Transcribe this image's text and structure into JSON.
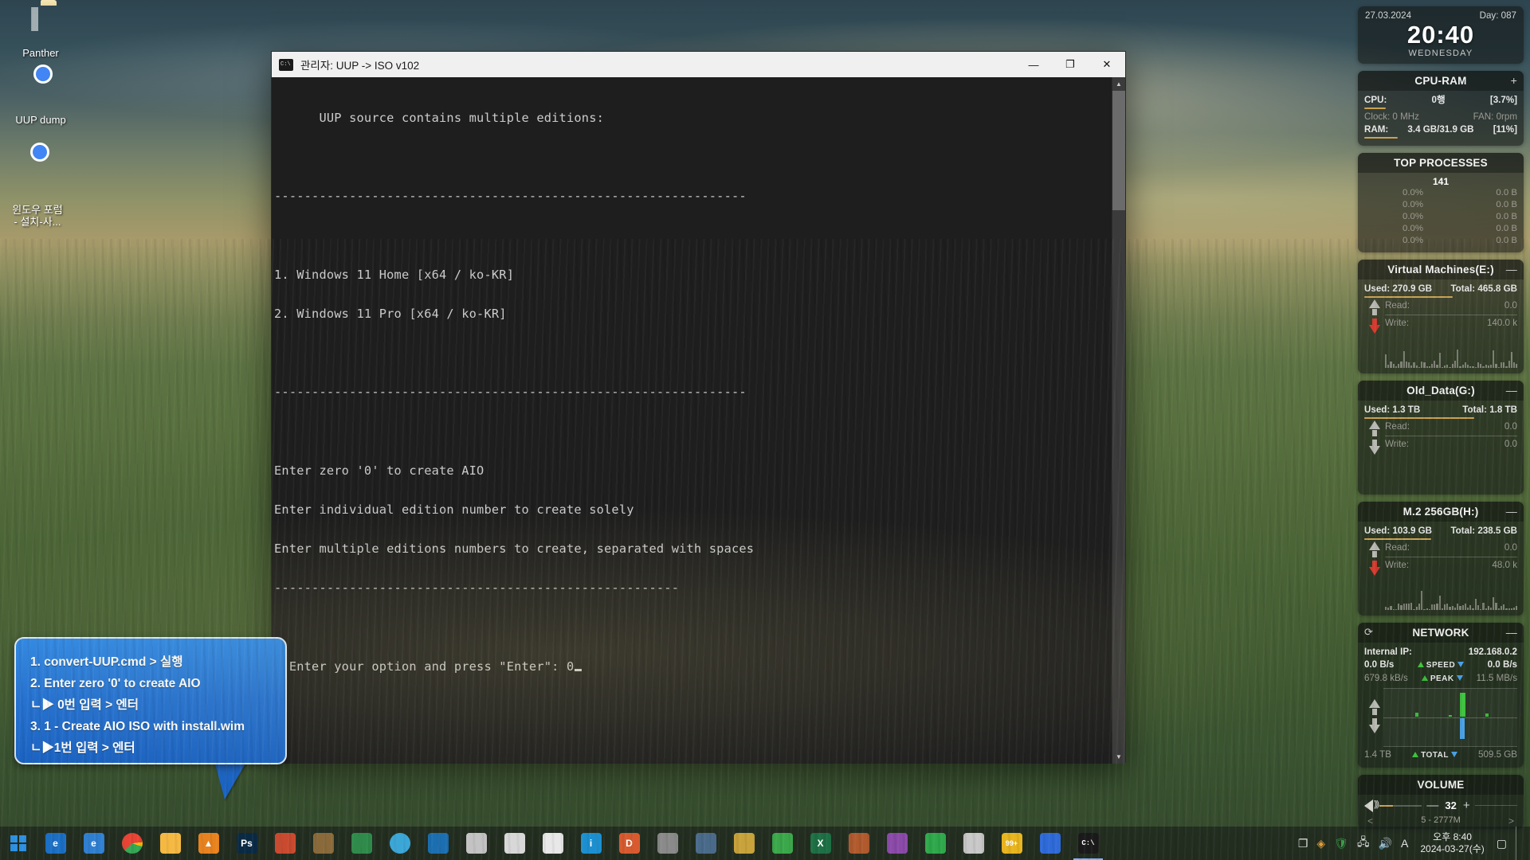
{
  "desktop": {
    "icons": [
      {
        "name": "Panther",
        "icon": "folder-icon"
      },
      {
        "name": "UUP dump",
        "icon": "chrome-icon"
      },
      {
        "name": "윈도우 포럼\n- 설치-사...",
        "icon": "chrome-icon"
      }
    ]
  },
  "console_window": {
    "title": "관리자:  UUP -> ISO v102",
    "icon": "cmd-icon",
    "buttons": {
      "minimize": "—",
      "maximize": "❐",
      "close": "✕"
    },
    "scrollbar": {
      "up": "▲",
      "down": "▼"
    },
    "lines": [
      "      UUP source contains multiple editions:",
      "",
      "---------------------------------------------------------------",
      "",
      "1. Windows 11 Home [x64 / ko-KR]",
      "2. Windows 11 Pro [x64 / ko-KR]",
      "",
      "---------------------------------------------------------------",
      "",
      "Enter zero '0' to create AIO",
      "Enter individual edition number to create solely",
      "Enter multiple editions numbers to create, separated with spaces",
      "------------------------------------------------------",
      "",
      "> Enter your option and press \"Enter\": 0"
    ],
    "prompt_line": "> Enter your option and press \"Enter\": ",
    "typed_value": "0"
  },
  "callout": {
    "lines": [
      "1. convert-UUP.cmd > 실행",
      "2. Enter zero '0' to create AIO",
      " ㄴ▶ 0번 입력 > 엔터",
      "3. 1 - Create AIO ISO with install.wim",
      " ㄴ▶1번 입력 > 엔터"
    ]
  },
  "sidebar": {
    "clock": {
      "date": "27.03.2024",
      "day_counter": "Day: 087",
      "time": "20:40",
      "weekday": "WEDNESDAY"
    },
    "cpu_ram": {
      "title": "CPU-RAM",
      "corner": "+",
      "cpu_label": "CPU:",
      "cpu_value": "0행",
      "cpu_percent": "[3.7%]",
      "clock_label": "Clock: 0 MHz",
      "fan_label": "FAN: 0rpm",
      "ram_label": "RAM:",
      "ram_value": "3.4 GB/31.9 GB",
      "ram_percent": "[11%]"
    },
    "top_processes": {
      "title": "TOP PROCESSES",
      "count": "141",
      "rows": [
        {
          "cpu": "0.0%",
          "mem": "0.0 B"
        },
        {
          "cpu": "0.0%",
          "mem": "0.0 B"
        },
        {
          "cpu": "0.0%",
          "mem": "0.0 B"
        },
        {
          "cpu": "0.0%",
          "mem": "0.0 B"
        },
        {
          "cpu": "0.0%",
          "mem": "0.0 B"
        }
      ]
    },
    "disks": [
      {
        "title": "Virtual Machines(E:)",
        "corner": "—",
        "used": "Used: 270.9 GB",
        "total": "Total: 465.8 GB",
        "read_label": "Read:",
        "read_value": "0.0",
        "write_label": "Write:",
        "write_value": "140.0 k",
        "bar_percent": 58
      },
      {
        "title": "Old_Data(G:)",
        "corner": "—",
        "used": "Used: 1.3 TB",
        "total": "Total: 1.8 TB",
        "read_label": "Read:",
        "read_value": "0.0",
        "write_label": "Write:",
        "write_value": "0.0",
        "bar_percent": 72
      },
      {
        "title": "M.2 256GB(H:)",
        "corner": "—",
        "used": "Used: 103.9 GB",
        "total": "Total: 238.5 GB",
        "read_label": "Read:",
        "read_value": "0.0",
        "write_label": "Write:",
        "write_value": "48.0 k",
        "bar_percent": 44
      }
    ],
    "network": {
      "title": "NETWORK",
      "corner": "—",
      "refresh_icon": "refresh-icon",
      "ip_label": "Internal IP:",
      "ip_value": "192.168.0.2",
      "speed_up": "0.0 B/s",
      "speed_label": "SPEED",
      "speed_down": "0.0 B/s",
      "peak_up": "679.8 kB/s",
      "peak_label": "PEAK",
      "peak_down": "11.5 MB/s",
      "total_up": "1.4 TB",
      "total_label": "TOTAL",
      "total_down": "509.5 GB"
    },
    "volume": {
      "title": "VOLUME",
      "minus": "—",
      "level": "32",
      "plus": "+",
      "track": "5 - 2777M",
      "prev": "<",
      "next": ">"
    }
  },
  "taskbar": {
    "start": "start-button",
    "items": [
      {
        "name": "edge",
        "label": "e",
        "color": "#1b6fc4"
      },
      {
        "name": "ie",
        "label": "e",
        "color": "#2f7fd0"
      },
      {
        "name": "chrome",
        "label": "",
        "color": "#e84335"
      },
      {
        "name": "file-explorer",
        "label": "",
        "color": "#f5b942"
      },
      {
        "name": "vlc",
        "label": "▲",
        "color": "#e8821e"
      },
      {
        "name": "photoshop",
        "label": "Ps",
        "color": "#0a2a44"
      },
      {
        "name": "app-7",
        "label": "",
        "color": "#c94a2e"
      },
      {
        "name": "app-8",
        "label": "",
        "color": "#8a6a3a"
      },
      {
        "name": "app-9",
        "label": "",
        "color": "#2e8b4a"
      },
      {
        "name": "app-10",
        "label": "",
        "color": "#3ba7d8"
      },
      {
        "name": "app-11",
        "label": "",
        "color": "#1b6fb0"
      },
      {
        "name": "app-12",
        "label": "",
        "color": "#c3c3c3"
      },
      {
        "name": "app-13",
        "label": "",
        "color": "#d8d8d8"
      },
      {
        "name": "app-14",
        "label": "",
        "color": "#e8e8e8"
      },
      {
        "name": "app-15",
        "label": "i",
        "color": "#1b8fd0"
      },
      {
        "name": "app-16",
        "label": "D",
        "color": "#d85a2e"
      },
      {
        "name": "app-17",
        "label": "",
        "color": "#8a8a8a"
      },
      {
        "name": "app-18",
        "label": "",
        "color": "#4a6a8a"
      },
      {
        "name": "app-19",
        "label": "",
        "color": "#c8a23a"
      },
      {
        "name": "app-20",
        "label": "",
        "color": "#3aa84a"
      },
      {
        "name": "excel",
        "label": "X",
        "color": "#1d7044"
      },
      {
        "name": "app-22",
        "label": "",
        "color": "#b05a2e"
      },
      {
        "name": "app-23",
        "label": "",
        "color": "#8a4aa8"
      },
      {
        "name": "app-24",
        "label": "",
        "color": "#2ea84a"
      },
      {
        "name": "app-25",
        "label": "",
        "color": "#c8c8c8"
      },
      {
        "name": "app-26",
        "label": "99+",
        "color": "#e8b41e"
      },
      {
        "name": "app-27",
        "label": "",
        "color": "#2e6ad8"
      },
      {
        "name": "cmd-window",
        "label": "C:\\",
        "color": "#1a1a1a"
      }
    ],
    "tray": {
      "icons": [
        "task-view-icon",
        "drop-icon",
        "shield-icon",
        "network-icon",
        "volume-icon",
        "ime-icon"
      ],
      "ime": "A",
      "time": "오후 8:40",
      "date": "2024-03-27(수)",
      "notification": "notification-icon"
    }
  }
}
